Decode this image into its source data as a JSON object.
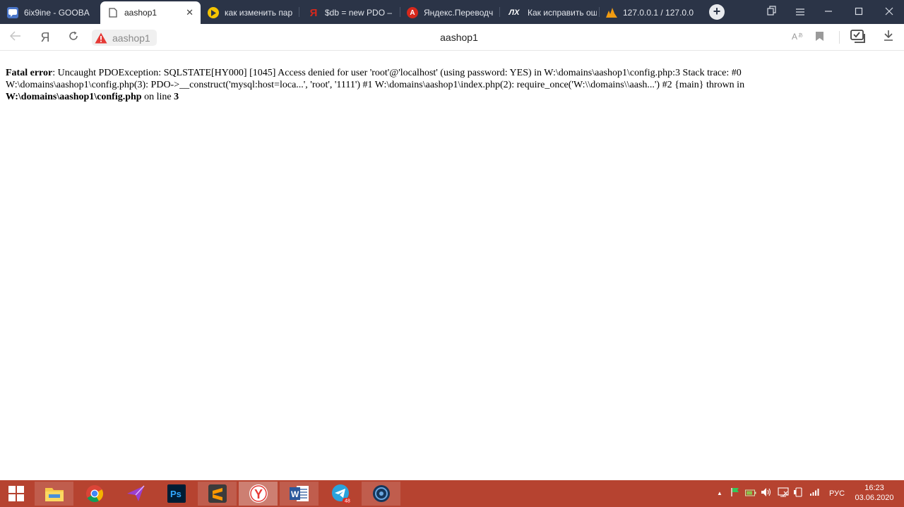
{
  "tabs": [
    {
      "title": "6ix9ine - GOOBA",
      "icon": "chat-icon",
      "icon_color": "#4a76c9",
      "active": false
    },
    {
      "title": "aashop1",
      "icon": "page-icon",
      "active": true
    },
    {
      "title": "как изменить пар",
      "icon": "play-icon",
      "icon_color": "#f5c400",
      "active": false
    },
    {
      "title": "$db = new PDO –",
      "icon": "yandex-icon",
      "icon_color": "#d7281c",
      "active": false
    },
    {
      "title": "Яндекс.Переводч",
      "icon": "translate-icon",
      "icon_color": "#d7281c",
      "active": false
    },
    {
      "title": "Как исправить ош",
      "icon": "lx-icon",
      "icon_text": "ЛХ",
      "active": false
    },
    {
      "title": "127.0.0.1 / 127.0.0",
      "icon": "phpmyadmin-icon",
      "icon_color": "#f29c11",
      "active": false
    }
  ],
  "address_bar": {
    "host": "aashop1",
    "page_title": "aashop1",
    "warning_icon": "warning-triangle-icon",
    "warning_color": "#e53935"
  },
  "error": {
    "label": "Fatal error",
    "message": ": Uncaught PDOException: SQLSTATE[HY000] [1045] Access denied for user 'root'@'localhost' (using password: YES) in W:\\domains\\aashop1\\config.php:3 Stack trace: #0 W:\\domains\\aashop1\\config.php(3): PDO->__construct('mysql:host=loca...', 'root', '1111') #1 W:\\domains\\aashop1\\index.php(2): require_once('W:\\\\domains\\\\aash...') #2 {main} thrown in",
    "file": "W:\\domains\\aashop1\\config.php",
    "on_line_text": " on line ",
    "line": "3"
  },
  "taskbar": {
    "apps": [
      "file-explorer-icon",
      "chrome-icon",
      "send-icon",
      "photoshop-icon",
      "sublime-text-icon",
      "yandex-browser-icon",
      "word-icon",
      "telegram-icon",
      "steam-icon"
    ],
    "telegram_badge": "48",
    "language": "РУС",
    "time": "16:23",
    "date": "03.06.2020",
    "tray_up": "▲",
    "accent": "#b64330"
  }
}
